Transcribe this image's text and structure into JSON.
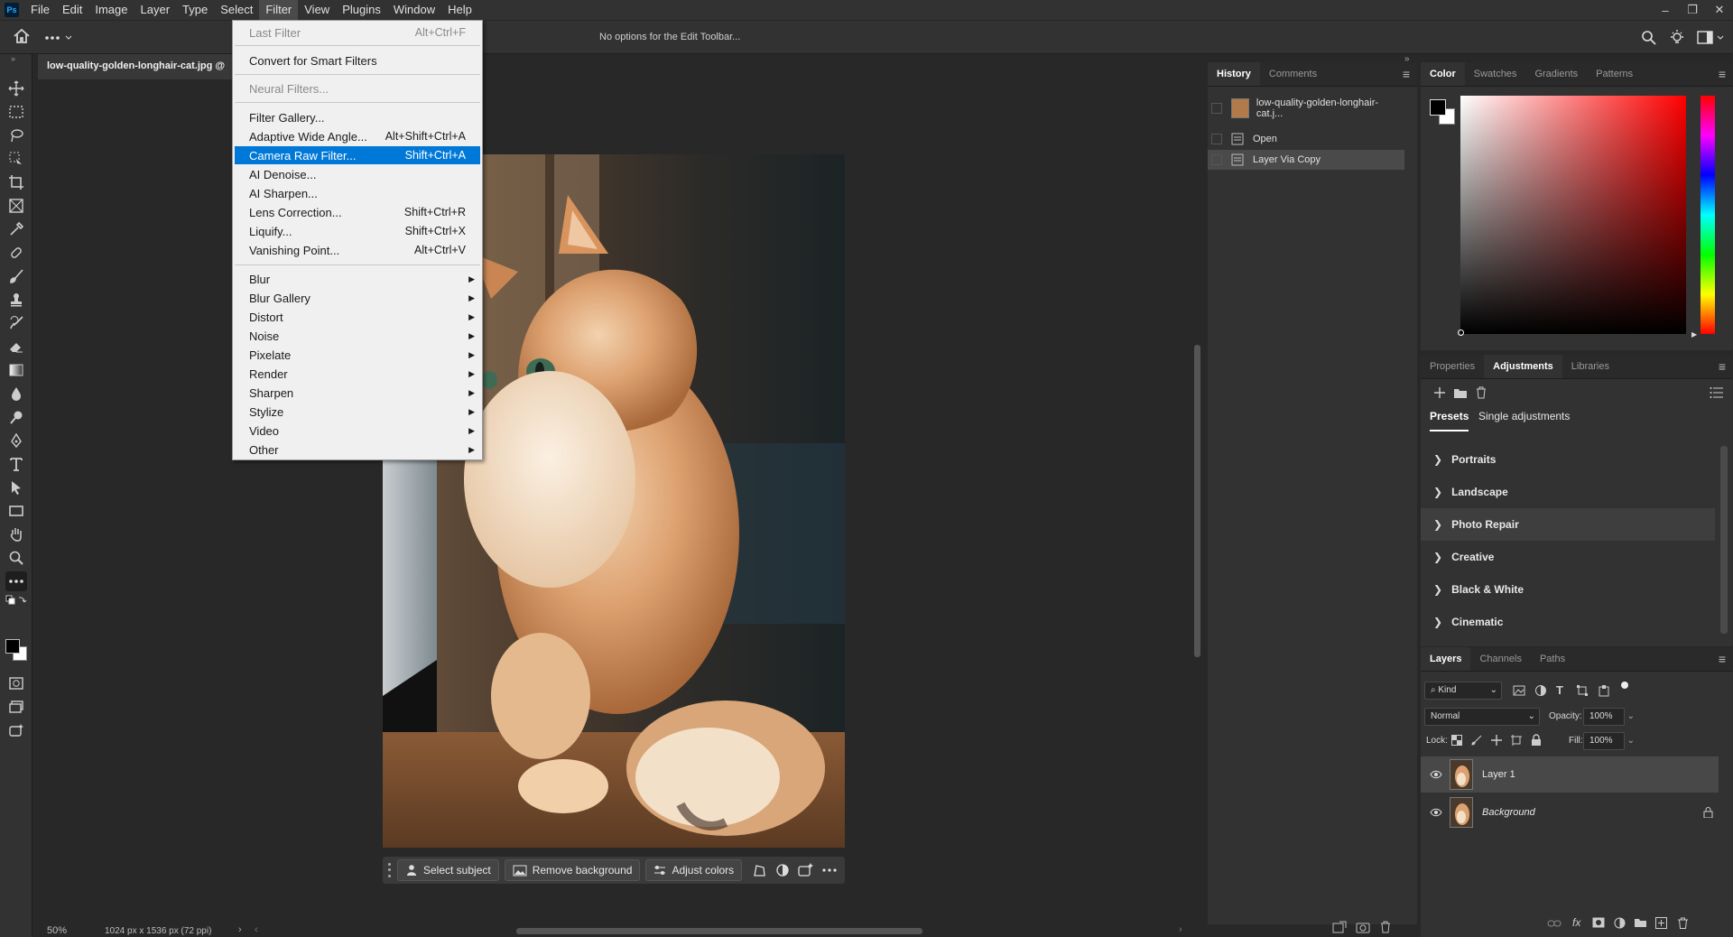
{
  "menubar": {
    "items": [
      "File",
      "Edit",
      "Image",
      "Layer",
      "Type",
      "Select",
      "Filter",
      "View",
      "Plugins",
      "Window",
      "Help"
    ],
    "active": "Filter"
  },
  "optionsbar": {
    "message": "No options for the Edit Toolbar..."
  },
  "document": {
    "tab_title": "low-quality-golden-longhair-cat.jpg @"
  },
  "filter_menu": {
    "last_filter": {
      "label": "Last Filter",
      "shortcut": "Alt+Ctrl+F"
    },
    "smart": {
      "label": "Convert for Smart Filters"
    },
    "neural": {
      "label": "Neural Filters..."
    },
    "gallery": {
      "label": "Filter Gallery..."
    },
    "adaptive": {
      "label": "Adaptive Wide Angle...",
      "shortcut": "Alt+Shift+Ctrl+A"
    },
    "camera_raw": {
      "label": "Camera Raw Filter...",
      "shortcut": "Shift+Ctrl+A"
    },
    "denoise": {
      "label": "AI Denoise..."
    },
    "sharpen_ai": {
      "label": "AI Sharpen..."
    },
    "lens": {
      "label": "Lens Correction...",
      "shortcut": "Shift+Ctrl+R"
    },
    "liquify": {
      "label": "Liquify...",
      "shortcut": "Shift+Ctrl+X"
    },
    "vanishing": {
      "label": "Vanishing Point...",
      "shortcut": "Alt+Ctrl+V"
    },
    "submenus": [
      "Blur",
      "Blur Gallery",
      "Distort",
      "Noise",
      "Pixelate",
      "Render",
      "Sharpen",
      "Stylize",
      "Video",
      "Other"
    ]
  },
  "contextbar": {
    "select_subject": "Select subject",
    "remove_background": "Remove background",
    "adjust_colors": "Adjust colors"
  },
  "status": {
    "zoom": "50%",
    "dims": "1024 px x 1536 px (72 ppi)"
  },
  "history": {
    "tabs": [
      "History",
      "Comments"
    ],
    "snapshot": "low-quality-golden-longhair-cat.j...",
    "steps": [
      "Open",
      "Layer Via Copy"
    ]
  },
  "color_panel": {
    "tabs": [
      "Color",
      "Swatches",
      "Gradients",
      "Patterns"
    ],
    "base_hue": "#ff0000"
  },
  "adjustments": {
    "tabs": [
      "Properties",
      "Adjustments",
      "Libraries"
    ],
    "subtabs": [
      "Presets",
      "Single adjustments"
    ],
    "groups": [
      "Portraits",
      "Landscape",
      "Photo Repair",
      "Creative",
      "Black & White",
      "Cinematic"
    ]
  },
  "layers_panel": {
    "tabs": [
      "Layers",
      "Channels",
      "Paths"
    ],
    "kind": "Kind",
    "blend": "Normal",
    "opacity_label": "Opacity:",
    "opacity": "100%",
    "lock_label": "Lock:",
    "fill_label": "Fill:",
    "fill": "100%",
    "layers": [
      "Layer 1",
      "Background"
    ]
  }
}
